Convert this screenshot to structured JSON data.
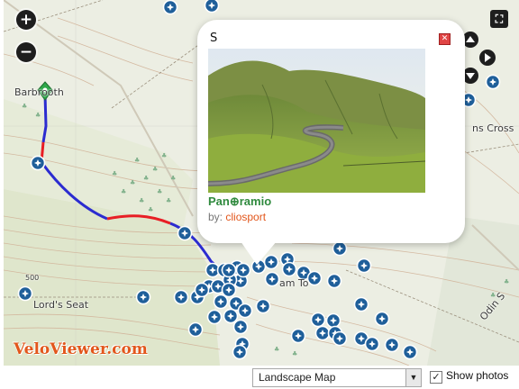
{
  "map": {
    "zoom_in_label": "+",
    "zoom_out_label": "−",
    "fullscreen_label": "⛶",
    "places": [
      {
        "name": "Barbrooth"
      },
      {
        "name": "Lord's Seat"
      },
      {
        "name": "Odin S"
      },
      {
        "name": "ns Cross"
      },
      {
        "name": "am To"
      },
      {
        "name": "500"
      }
    ],
    "brand": "VeloViewer.com",
    "route_colors": {
      "climb": "#2b2bd0",
      "steep": "#e81e25"
    },
    "marker_color": "#1f5f9a",
    "start_marker_color": "#2fa84a",
    "pan_controls": [
      "pan-up-icon",
      "pan-left-icon",
      "pan-right-icon",
      "pan-down-icon"
    ]
  },
  "popup": {
    "title": "S",
    "close_label": "✕",
    "logo_text": "Pan⊕ramio",
    "by_label": "by:",
    "user": "cliosport"
  },
  "footer": {
    "map_type_selected": "Landscape Map",
    "show_photos_label": "Show photos",
    "show_photos_checked": true
  }
}
